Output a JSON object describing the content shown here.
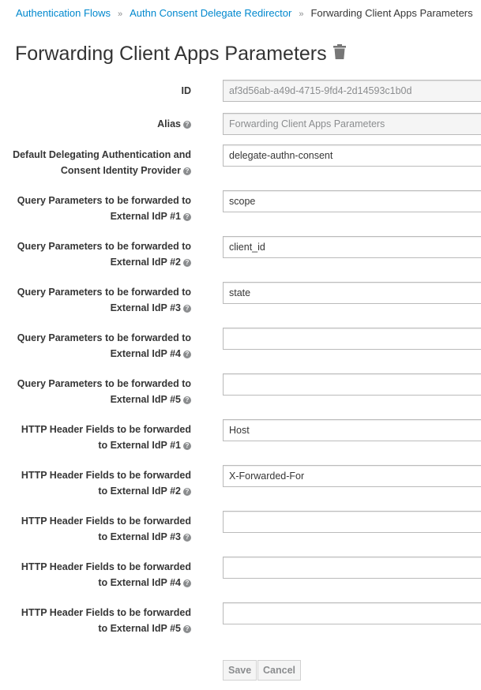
{
  "breadcrumb": [
    "Authentication Flows",
    "Authn Consent Delegate Redirector",
    "Forwarding Client Apps Parameters"
  ],
  "title": "Forwarding Client Apps Parameters",
  "fields": [
    {
      "label": [
        "ID"
      ],
      "value": "af3d56ab-a49d-4715-9fd4-2d14593c1b0d",
      "readonly": true,
      "help": false
    },
    {
      "label": [
        "Alias"
      ],
      "value": "Forwarding Client Apps Parameters",
      "readonly": true,
      "help": true
    },
    {
      "label": [
        "Default Delegating Authentication and",
        "Consent Identity Provider"
      ],
      "value": "delegate-authn-consent",
      "help": true
    },
    {
      "label": [
        "Query Parameters to be forwarded to",
        "External IdP #1"
      ],
      "value": "scope",
      "help": true
    },
    {
      "label": [
        "Query Parameters to be forwarded to",
        "External IdP #2"
      ],
      "value": "client_id",
      "help": true
    },
    {
      "label": [
        "Query Parameters to be forwarded to",
        "External IdP #3"
      ],
      "value": "state",
      "help": true
    },
    {
      "label": [
        "Query Parameters to be forwarded to",
        "External IdP #4"
      ],
      "value": "",
      "help": true
    },
    {
      "label": [
        "Query Parameters to be forwarded to",
        "External IdP #5"
      ],
      "value": "",
      "help": true
    },
    {
      "label": [
        "HTTP Header Fields to be forwarded",
        "to External IdP #1"
      ],
      "value": "Host",
      "help": true
    },
    {
      "label": [
        "HTTP Header Fields to be forwarded",
        "to External IdP #2"
      ],
      "value": "X-Forwarded-For",
      "help": true
    },
    {
      "label": [
        "HTTP Header Fields to be forwarded",
        "to External IdP #3"
      ],
      "value": "",
      "help": true
    },
    {
      "label": [
        "HTTP Header Fields to be forwarded",
        "to External IdP #4"
      ],
      "value": "",
      "help": true
    },
    {
      "label": [
        "HTTP Header Fields to be forwarded",
        "to External IdP #5"
      ],
      "value": "",
      "help": true
    }
  ],
  "buttons": {
    "save": "Save",
    "cancel": "Cancel"
  }
}
